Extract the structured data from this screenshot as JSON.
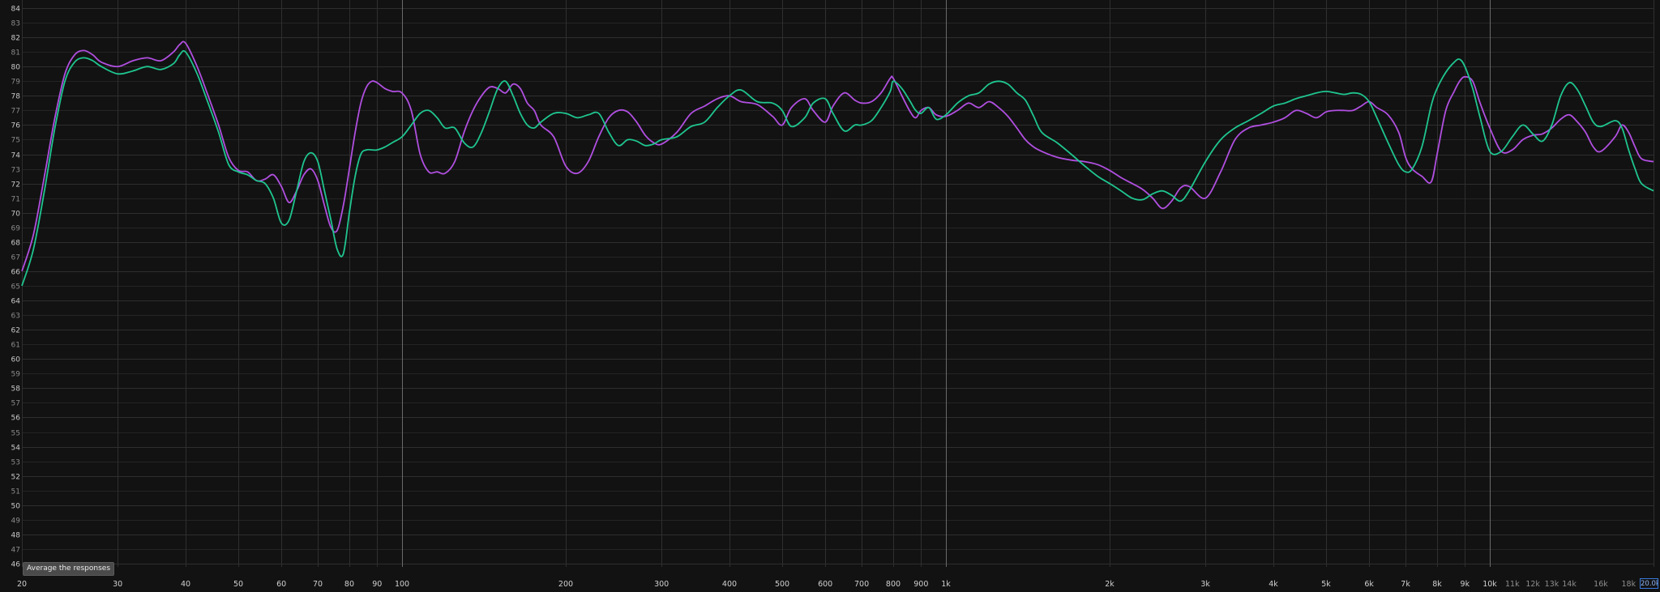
{
  "chart_data": {
    "type": "line",
    "title": "",
    "xlabel": "",
    "ylabel": "",
    "x_scale": "log",
    "xlim": [
      20,
      20000
    ],
    "ylim": [
      45.5,
      84.5
    ],
    "grid": true,
    "y_ticks": [
      46,
      47,
      48,
      49,
      50,
      51,
      52,
      53,
      54,
      55,
      56,
      57,
      58,
      59,
      60,
      61,
      62,
      63,
      64,
      65,
      66,
      67,
      68,
      69,
      70,
      71,
      72,
      73,
      74,
      75,
      76,
      77,
      78,
      79,
      80,
      81,
      82,
      83,
      84
    ],
    "y_tick_labels": [
      "46",
      "47",
      "48",
      "49",
      "50",
      "51",
      "52",
      "53",
      "54",
      "55",
      "56",
      "57",
      "58",
      "59",
      "60",
      "61",
      "62",
      "63",
      "64",
      "65",
      "66",
      "67",
      "68",
      "69",
      "70",
      "71",
      "72",
      "73",
      "74",
      "75",
      "76",
      "77",
      "78",
      "79",
      "80",
      "81",
      "82",
      "83",
      "84"
    ],
    "x_ticks": [
      {
        "v": 20,
        "label": "20"
      },
      {
        "v": 30,
        "label": "30"
      },
      {
        "v": 40,
        "label": "40"
      },
      {
        "v": 50,
        "label": "50"
      },
      {
        "v": 60,
        "label": "60"
      },
      {
        "v": 70,
        "label": "70"
      },
      {
        "v": 80,
        "label": "80"
      },
      {
        "v": 90,
        "label": "90"
      },
      {
        "v": 100,
        "label": "100"
      },
      {
        "v": 200,
        "label": "200"
      },
      {
        "v": 300,
        "label": "300"
      },
      {
        "v": 400,
        "label": "400"
      },
      {
        "v": 500,
        "label": "500"
      },
      {
        "v": 600,
        "label": "600"
      },
      {
        "v": 700,
        "label": "700"
      },
      {
        "v": 800,
        "label": "800"
      },
      {
        "v": 900,
        "label": "900"
      },
      {
        "v": 1000,
        "label": "1k"
      },
      {
        "v": 2000,
        "label": "2k"
      },
      {
        "v": 3000,
        "label": "3k"
      },
      {
        "v": 4000,
        "label": "4k"
      },
      {
        "v": 5000,
        "label": "5k"
      },
      {
        "v": 6000,
        "label": "6k"
      },
      {
        "v": 7000,
        "label": "7k"
      },
      {
        "v": 8000,
        "label": "8k"
      },
      {
        "v": 9000,
        "label": "9k"
      },
      {
        "v": 10000,
        "label": "10k"
      },
      {
        "v": 11000,
        "label": "11k",
        "dim": true
      },
      {
        "v": 12000,
        "label": "12k",
        "dim": true
      },
      {
        "v": 13000,
        "label": "13k",
        "dim": true
      },
      {
        "v": 14000,
        "label": "14k",
        "dim": true
      },
      {
        "v": 16000,
        "label": "16k",
        "dim": true
      },
      {
        "v": 18000,
        "label": "18k",
        "dim": true
      }
    ],
    "major_x_lines": [
      100,
      1000,
      10000
    ],
    "series": [
      {
        "color": "#b04fe0",
        "x": [
          20,
          21,
          22,
          23,
          24,
          25,
          26,
          27,
          28,
          30,
          32,
          34,
          36,
          38,
          39,
          40,
          42,
          44,
          46,
          48,
          50,
          52,
          54,
          56,
          58,
          60,
          62,
          64,
          66,
          68,
          70,
          72,
          74,
          76,
          78,
          80,
          82,
          84,
          86,
          88,
          90,
          93,
          96,
          100,
          104,
          108,
          112,
          116,
          120,
          125,
          130,
          135,
          140,
          145,
          150,
          155,
          160,
          165,
          170,
          175,
          180,
          190,
          200,
          210,
          220,
          230,
          240,
          250,
          260,
          270,
          280,
          290,
          300,
          320,
          340,
          360,
          380,
          400,
          420,
          450,
          480,
          500,
          520,
          550,
          570,
          600,
          620,
          650,
          680,
          700,
          730,
          760,
          790,
          800,
          830,
          860,
          880,
          900,
          930,
          960,
          1000,
          1050,
          1100,
          1150,
          1200,
          1250,
          1300,
          1350,
          1400,
          1450,
          1500,
          1600,
          1700,
          1800,
          1900,
          2000,
          2100,
          2200,
          2300,
          2400,
          2500,
          2600,
          2700,
          2800,
          3000,
          3200,
          3400,
          3600,
          3800,
          4000,
          4200,
          4400,
          4600,
          4800,
          5000,
          5200,
          5400,
          5600,
          5800,
          6000,
          6200,
          6500,
          6800,
          7000,
          7200,
          7500,
          7800,
          8000,
          8300,
          8600,
          8800,
          9000,
          9300,
          9600,
          10000,
          10500,
          11000,
          11500,
          12000,
          12500,
          13000,
          13500,
          14000,
          14500,
          15000,
          15500,
          16000,
          17000,
          17500,
          18000,
          18500,
          19000,
          20000
        ],
        "y": [
          66.0,
          68.5,
          72.5,
          76.5,
          79.5,
          80.8,
          81.1,
          80.8,
          80.3,
          80.0,
          80.4,
          80.6,
          80.4,
          81.0,
          81.5,
          81.6,
          80.0,
          78.0,
          76.0,
          73.8,
          72.9,
          72.8,
          72.2,
          72.3,
          72.6,
          71.8,
          70.7,
          71.5,
          72.6,
          73.0,
          72.2,
          70.5,
          69.0,
          68.8,
          70.5,
          73.0,
          75.5,
          77.5,
          78.6,
          79.0,
          78.9,
          78.5,
          78.3,
          78.2,
          77.0,
          74.0,
          72.8,
          72.8,
          72.7,
          73.5,
          75.5,
          77.0,
          78.0,
          78.6,
          78.5,
          78.2,
          78.8,
          78.5,
          77.5,
          77.0,
          76.0,
          75.2,
          73.2,
          72.7,
          73.5,
          75.2,
          76.5,
          77.0,
          76.9,
          76.2,
          75.3,
          74.8,
          74.7,
          75.5,
          76.8,
          77.3,
          77.8,
          78.0,
          77.6,
          77.4,
          76.6,
          76.0,
          77.2,
          77.8,
          77.0,
          76.2,
          77.3,
          78.2,
          77.7,
          77.5,
          77.6,
          78.2,
          79.2,
          79.2,
          78.0,
          76.9,
          76.5,
          77.0,
          77.2,
          76.7,
          76.6,
          77.0,
          77.5,
          77.2,
          77.6,
          77.2,
          76.6,
          75.8,
          75.0,
          74.5,
          74.2,
          73.8,
          73.6,
          73.5,
          73.3,
          72.9,
          72.4,
          72.0,
          71.6,
          71.0,
          70.3,
          70.8,
          71.7,
          71.8,
          71.0,
          72.8,
          75.0,
          75.8,
          76.0,
          76.2,
          76.5,
          77.0,
          76.8,
          76.5,
          76.9,
          77.0,
          77.0,
          77.0,
          77.3,
          77.6,
          77.2,
          76.7,
          75.5,
          73.8,
          73.0,
          72.5,
          72.1,
          74.0,
          77.0,
          78.3,
          79.0,
          79.3,
          79.0,
          77.5,
          75.8,
          74.2,
          74.3,
          75.0,
          75.3,
          75.4,
          75.8,
          76.4,
          76.7,
          76.2,
          75.5,
          74.5,
          74.2,
          75.2,
          76.0,
          75.5,
          74.5,
          73.7,
          73.5
        ]
      },
      {
        "color": "#1fc58f",
        "x": [
          20,
          21,
          22,
          23,
          24,
          25,
          26,
          27,
          28,
          30,
          32,
          34,
          36,
          38,
          39,
          40,
          42,
          44,
          46,
          48,
          50,
          52,
          54,
          56,
          58,
          60,
          62,
          64,
          66,
          68,
          70,
          72,
          74,
          76,
          78,
          80,
          82,
          84,
          86,
          88,
          90,
          93,
          96,
          100,
          104,
          108,
          112,
          116,
          120,
          125,
          130,
          135,
          140,
          145,
          150,
          155,
          160,
          165,
          170,
          175,
          180,
          190,
          200,
          210,
          220,
          230,
          240,
          250,
          260,
          270,
          280,
          290,
          300,
          320,
          340,
          360,
          380,
          400,
          420,
          450,
          480,
          500,
          520,
          550,
          570,
          600,
          620,
          650,
          680,
          700,
          730,
          760,
          790,
          800,
          830,
          860,
          880,
          900,
          930,
          960,
          1000,
          1050,
          1100,
          1150,
          1200,
          1250,
          1300,
          1350,
          1400,
          1450,
          1500,
          1600,
          1700,
          1800,
          1900,
          2000,
          2100,
          2200,
          2300,
          2400,
          2500,
          2600,
          2700,
          2800,
          3000,
          3200,
          3400,
          3600,
          3800,
          4000,
          4200,
          4400,
          4600,
          4800,
          5000,
          5200,
          5400,
          5600,
          5800,
          6000,
          6200,
          6500,
          6800,
          7000,
          7200,
          7500,
          7800,
          8000,
          8300,
          8600,
          8800,
          9000,
          9300,
          9600,
          10000,
          10500,
          11000,
          11500,
          12000,
          12500,
          13000,
          13500,
          14000,
          14500,
          15000,
          15500,
          16000,
          17000,
          17500,
          18000,
          18500,
          19000,
          20000
        ],
        "y": [
          65.0,
          67.5,
          71.5,
          75.8,
          79.0,
          80.3,
          80.6,
          80.4,
          80.0,
          79.5,
          79.7,
          80.0,
          79.8,
          80.2,
          80.8,
          81.0,
          79.5,
          77.5,
          75.5,
          73.3,
          72.8,
          72.6,
          72.2,
          72.0,
          71.0,
          69.3,
          69.5,
          71.5,
          73.5,
          74.1,
          73.5,
          71.5,
          69.5,
          67.5,
          67.2,
          70.0,
          72.5,
          74.0,
          74.3,
          74.3,
          74.3,
          74.5,
          74.8,
          75.2,
          76.0,
          76.8,
          77.0,
          76.5,
          75.8,
          75.8,
          74.8,
          74.5,
          75.5,
          77.0,
          78.5,
          79.0,
          78.0,
          76.8,
          76.0,
          75.8,
          76.2,
          76.8,
          76.8,
          76.5,
          76.7,
          76.8,
          75.5,
          74.6,
          75.0,
          74.9,
          74.6,
          74.7,
          75.0,
          75.2,
          75.9,
          76.2,
          77.2,
          78.0,
          78.4,
          77.6,
          77.5,
          77.0,
          75.9,
          76.5,
          77.5,
          77.8,
          76.8,
          75.6,
          76.0,
          76.0,
          76.3,
          77.2,
          78.3,
          79.0,
          78.5,
          77.6,
          77.0,
          76.8,
          77.2,
          76.4,
          76.7,
          77.5,
          78.0,
          78.2,
          78.8,
          79.0,
          78.8,
          78.2,
          77.7,
          76.6,
          75.5,
          74.8,
          74.0,
          73.2,
          72.5,
          72.0,
          71.5,
          71.0,
          70.9,
          71.3,
          71.5,
          71.2,
          70.8,
          71.5,
          73.5,
          75.0,
          75.8,
          76.3,
          76.8,
          77.3,
          77.5,
          77.8,
          78.0,
          78.2,
          78.3,
          78.2,
          78.1,
          78.2,
          78.1,
          77.6,
          76.5,
          74.8,
          73.3,
          72.8,
          73.0,
          74.5,
          77.3,
          78.5,
          79.6,
          80.3,
          80.5,
          80.0,
          78.5,
          76.5,
          74.2,
          74.2,
          75.2,
          76.0,
          75.4,
          74.9,
          76.0,
          78.0,
          78.9,
          78.4,
          77.3,
          76.2,
          75.9,
          76.3,
          75.8,
          74.3,
          73.0,
          72.0,
          71.5
        ]
      }
    ]
  },
  "ui": {
    "tooltip_text": "Average the responses",
    "end_box_text": "20.0k"
  }
}
